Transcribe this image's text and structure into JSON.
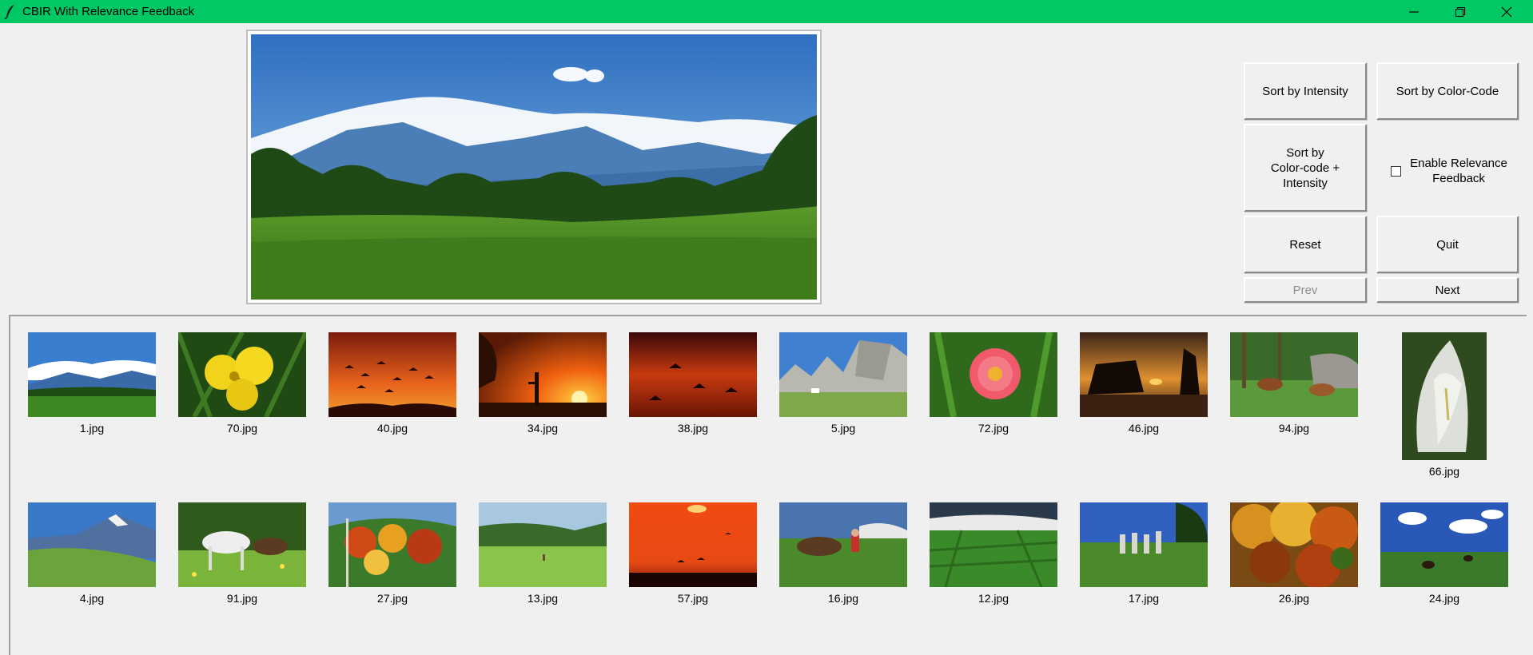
{
  "window": {
    "title": "CBIR With Relevance Feedback",
    "controls": [
      "minimize-icon",
      "restore-icon",
      "close-icon"
    ],
    "titlebar_color": "#00c864"
  },
  "preview": {
    "image": "mountain-landscape-image"
  },
  "buttons": {
    "sort_intensity": "Sort by Intensity",
    "sort_color_code": "Sort by Color-Code",
    "sort_combo_l1": "Sort by",
    "sort_combo_l2": "Color-code +",
    "sort_combo_l3": "Intensity",
    "reset": "Reset",
    "quit": "Quit",
    "prev": "Prev",
    "next": "Next"
  },
  "relevance_feedback": {
    "label_l1": "Enable Relevance",
    "label_l2": "Feedback",
    "checked": false
  },
  "gallery": {
    "row1": [
      "1.jpg",
      "70.jpg",
      "40.jpg",
      "34.jpg",
      "38.jpg",
      "5.jpg",
      "72.jpg",
      "46.jpg",
      "94.jpg",
      "66.jpg"
    ],
    "row2": [
      "4.jpg",
      "91.jpg",
      "27.jpg",
      "13.jpg",
      "57.jpg",
      "16.jpg",
      "12.jpg",
      "17.jpg",
      "26.jpg",
      "24.jpg"
    ]
  }
}
